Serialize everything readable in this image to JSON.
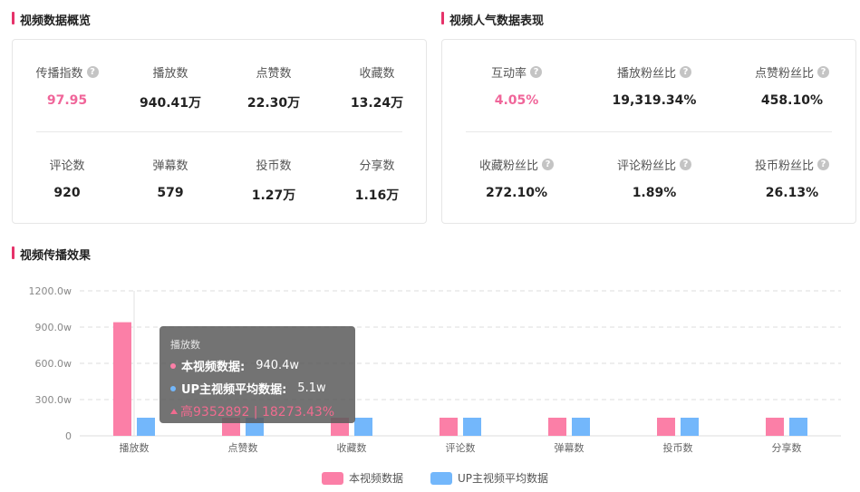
{
  "overview": {
    "title": "视频数据概览",
    "row1": [
      {
        "label": "传播指数",
        "value": "97.95",
        "help": true,
        "pink": true
      },
      {
        "label": "播放数",
        "value": "940.41万"
      },
      {
        "label": "点赞数",
        "value": "22.30万"
      },
      {
        "label": "收藏数",
        "value": "13.24万"
      }
    ],
    "row2": [
      {
        "label": "评论数",
        "value": "920"
      },
      {
        "label": "弹幕数",
        "value": "579"
      },
      {
        "label": "投币数",
        "value": "1.27万"
      },
      {
        "label": "分享数",
        "value": "1.16万"
      }
    ]
  },
  "popularity": {
    "title": "视频人气数据表现",
    "row1": [
      {
        "label": "互动率",
        "value": "4.05%",
        "help": true,
        "pink": true
      },
      {
        "label": "播放粉丝比",
        "value": "19,319.34%",
        "help": true
      },
      {
        "label": "点赞粉丝比",
        "value": "458.10%",
        "help": true
      }
    ],
    "row2": [
      {
        "label": "收藏粉丝比",
        "value": "272.10%",
        "help": true
      },
      {
        "label": "评论粉丝比",
        "value": "1.89%",
        "help": true
      },
      {
        "label": "投币粉丝比",
        "value": "26.13%",
        "help": true
      }
    ]
  },
  "spread": {
    "title": "视频传播效果"
  },
  "colors": {
    "accent": "#e6336a",
    "series1": "#fb7fa7",
    "series2": "#73b7fb",
    "pink_text": "#f0669a"
  },
  "chart_data": {
    "type": "bar",
    "categories": [
      "播放数",
      "点赞数",
      "收藏数",
      "评论数",
      "弹幕数",
      "投币数",
      "分享数"
    ],
    "y_tick_labels": [
      "0",
      "300.0w",
      "600.0w",
      "900.0w",
      "1200.0w"
    ],
    "ylim": [
      0,
      1200
    ],
    "series": [
      {
        "name": "本视频数据",
        "values": [
          940.4,
          150,
          150,
          150,
          150,
          150,
          150
        ],
        "color": "#fb7fa7"
      },
      {
        "name": "UP主视频平均数据",
        "values": [
          150,
          150,
          150,
          150,
          150,
          150,
          150
        ],
        "color": "#73b7fb"
      }
    ],
    "grid": true,
    "legend_position": "bottom"
  },
  "tooltip": {
    "title": "播放数",
    "rows": [
      {
        "key": "本视频数据:",
        "value": "940.4w",
        "color": "#fb7fa7"
      },
      {
        "key": "UP主视频平均数据:",
        "value": "5.1w",
        "color": "#73b7fb"
      }
    ],
    "diff": "高9352892 | 18273.43%"
  }
}
